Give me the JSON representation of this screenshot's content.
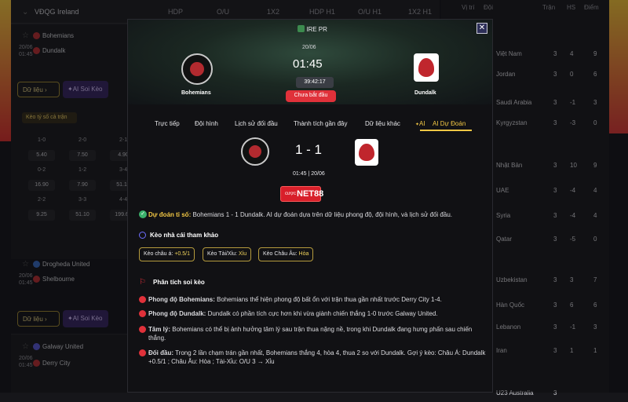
{
  "background": {
    "league": "VĐQG Ireland",
    "columns": [
      "HDP",
      "O/U",
      "1X2",
      "HDP H1",
      "O/U H1",
      "1X2 H1"
    ],
    "match1": {
      "team1": "Bohemians",
      "team2": "Dundalk",
      "date": "20/06",
      "time": "01:45"
    },
    "match2": {
      "team1": "Drogheda United",
      "team2": "Shelbourne",
      "date": "20/06",
      "time": "01:45"
    },
    "match3": {
      "team1": "Galway United",
      "team2": "Derry City",
      "date": "20/06",
      "time": "01:45"
    },
    "btn_data": "Dữ liệu",
    "btn_ai": "AI Soi Kèo",
    "score_odds_label": "Kèo tỷ số cả trận",
    "score_odds": [
      {
        "s": "1-0",
        "v": "5.40"
      },
      {
        "s": "2-0",
        "v": "7.50"
      },
      {
        "s": "2-1",
        "v": "4.90"
      },
      {
        "s": "0-2",
        "v": "16.90"
      },
      {
        "s": "1-2",
        "v": "7.90"
      },
      {
        "s": "3-4",
        "v": "51.10"
      },
      {
        "s": "2-2",
        "v": "9.25"
      },
      {
        "s": "3-3",
        "v": "51.10"
      },
      {
        "s": "4-4",
        "v": "199.60"
      }
    ],
    "rank_headers": {
      "pos": "Vị trí",
      "team": "Đội",
      "played": "Trận",
      "hs": "HS",
      "pts": "Điểm"
    },
    "ranks": [
      {
        "team": "Việt Nam",
        "p": "3",
        "hs": "4",
        "pts": "9"
      },
      {
        "team": "Jordan",
        "p": "3",
        "hs": "0",
        "pts": "6"
      },
      {
        "team": "Saudi Arabia",
        "p": "3",
        "hs": "-1",
        "pts": "3"
      },
      {
        "team": "Kyrgyzstan",
        "p": "3",
        "hs": "-3",
        "pts": "0"
      },
      {
        "team": "Nhật Bản",
        "p": "3",
        "hs": "10",
        "pts": "9"
      },
      {
        "team": "UAE",
        "p": "3",
        "hs": "-4",
        "pts": "4"
      },
      {
        "team": "Syria",
        "p": "3",
        "hs": "-4",
        "pts": "4"
      },
      {
        "team": "Qatar",
        "p": "3",
        "hs": "-5",
        "pts": "0"
      },
      {
        "team": "Uzbekistan",
        "p": "3",
        "hs": "3",
        "pts": "7"
      },
      {
        "team": "Hàn Quốc",
        "p": "3",
        "hs": "6",
        "pts": "6"
      },
      {
        "team": "Lebanon",
        "p": "3",
        "hs": "-1",
        "pts": "3"
      },
      {
        "team": "Iran",
        "p": "3",
        "hs": "1",
        "pts": "1"
      },
      {
        "team": "U23 Australia",
        "p": "3",
        "hs": "",
        "pts": ""
      }
    ]
  },
  "modal": {
    "league": "IRE PR",
    "date": "20/06",
    "time": "01:45",
    "countdown": "39:42:17",
    "status": "Chưa bắt đầu",
    "home": "Bohemians",
    "away": "Dundalk",
    "tabs": [
      "Trực tiếp",
      "Đội hình",
      "Lịch sử đối đầu",
      "Thành tích gần đây",
      "Dữ liệu khác",
      "AI Dự Đoán"
    ],
    "ai_label": "AI",
    "score": "1 - 1",
    "kickoff": "01:45 | 20/06",
    "ad": {
      "prefix": "cược",
      "brand": "NET88"
    },
    "prediction_label": "Dự đoán tỉ số:",
    "prediction_text": "Bohemians 1 - 1 Dundalk. AI dự đoán dựa trên dữ liệu phong độ, đội hình, và lịch sử đối đầu.",
    "odds_title": "Kèo nhà cái tham khảo",
    "chips": [
      {
        "label": "Kèo châu á:",
        "value": "+0.5/1"
      },
      {
        "label": "Kèo Tài/Xỉu:",
        "value": "Xỉu"
      },
      {
        "label": "Kèo Châu Âu:",
        "value": "Hòa"
      }
    ],
    "analysis_title": "Phân tích soi kèo",
    "analysis": [
      {
        "label": "Phong độ Bohemians:",
        "text": "Bohemians thể hiện phong độ bất ổn với trận thua gần nhất trước Derry City 1-4."
      },
      {
        "label": "Phong độ Dundalk:",
        "text": "Dundalk có phần tích cực hơn khi vừa giành chiến thắng 1-0 trước Galway United."
      },
      {
        "label": "Tâm lý:",
        "text": "Bohemians có thể bị ảnh hưởng tâm lý sau trận thua nặng nề, trong khi Dundalk đang hưng phấn sau chiến thắng."
      },
      {
        "label": "Đối đầu:",
        "text": "Trong 2 lần chạm trán gần nhất, Bohemians thắng 4, hòa 4, thua 2 so với Dundalk. Gợi ý kèo: Châu Á: Dundalk +0.5/1 ; Châu Âu: Hòa ; Tài-Xỉu: O/U 3 → Xỉu"
      }
    ]
  },
  "colors": {
    "accent_gold": "#f2c744",
    "status_red": "#e0313a",
    "brand_red": "#e3262f",
    "ok_green": "#3bb26b"
  }
}
